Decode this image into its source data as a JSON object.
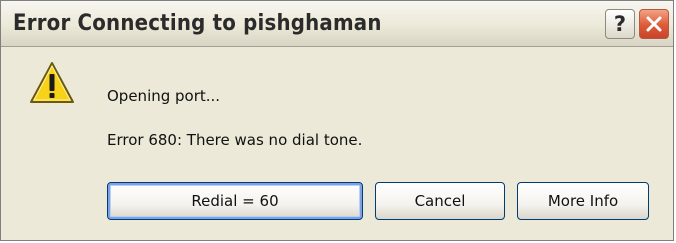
{
  "window": {
    "title": "Error Connecting to pishghaman",
    "help_glyph": "?",
    "icons": {
      "help": "help-icon",
      "close": "close-icon",
      "warning": "warning-icon"
    }
  },
  "message": {
    "line1": "Opening port...",
    "line2": "Error 680: There was no dial tone."
  },
  "buttons": {
    "redial": "Redial = 60",
    "cancel": "Cancel",
    "more_info": "More Info"
  },
  "colors": {
    "dialog_bg": "#ece9d8",
    "close_button": "#dd5a37",
    "warning_yellow": "#f7d218",
    "default_button_focus": "#7ea1e6"
  }
}
